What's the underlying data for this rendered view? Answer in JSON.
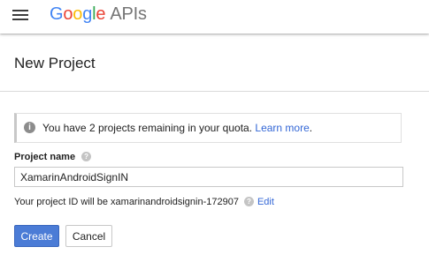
{
  "header": {
    "logo_letters": [
      {
        "char": "G",
        "color": "#4285F4"
      },
      {
        "char": "o",
        "color": "#EA4335"
      },
      {
        "char": "o",
        "color": "#FBBC05"
      },
      {
        "char": "g",
        "color": "#4285F4"
      },
      {
        "char": "l",
        "color": "#34A853"
      },
      {
        "char": "e",
        "color": "#EA4335"
      }
    ],
    "logo_suffix": "APIs",
    "menu_icon": "hamburger-menu-icon"
  },
  "page": {
    "title": "New Project"
  },
  "info": {
    "icon": "info-icon",
    "message": "You have 2 projects remaining in your quota.",
    "link_text": "Learn more",
    "trailing": "."
  },
  "form": {
    "project_name_label": "Project name",
    "help_icon": "help-icon",
    "project_name_value": "XamarinAndroidSignIN",
    "project_id_text": "Your project ID will be xamarinandroidsignin-172907",
    "edit_link": "Edit"
  },
  "buttons": {
    "create": "Create",
    "cancel": "Cancel"
  },
  "colors": {
    "link": "#3367d6",
    "primary_button": "#4b7cd6"
  }
}
